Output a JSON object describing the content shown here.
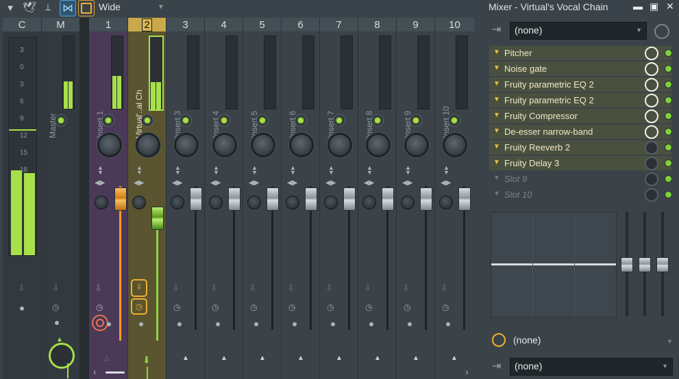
{
  "toolbar": {
    "preset_label": "Wide",
    "icons": [
      "chevron-down-icon",
      "bird-icon",
      "tuning-fork-icon",
      "bowtie-icon",
      "square-icon"
    ]
  },
  "title_bar": {
    "title": "Mixer - Virtual's Vocal Chain",
    "minimize": "▬",
    "maximize": "▣",
    "close": "✕"
  },
  "mixer": {
    "headers": [
      "C",
      "M",
      "1",
      "2",
      "3",
      "4",
      "5",
      "6",
      "7",
      "8",
      "9",
      "10"
    ],
    "insert_labels": [
      "Master",
      "Insert 1",
      "Virtual'..al Chain",
      "Insert 3",
      "Insert 4",
      "Insert 5",
      "Insert 6",
      "Insert 7",
      "Insert 8",
      "Insert 9",
      "Insert 10"
    ],
    "db_scale": [
      "3",
      "0",
      "3",
      "6",
      "9",
      "12",
      "15",
      "18"
    ],
    "selected_track": "2",
    "colors": {
      "track1": "#6a3a8a",
      "track2": "#c9a94a",
      "meter": "#a8e049",
      "fader_orange": "#f0a020",
      "fader_green": "#8fd640",
      "record": "#f07050"
    }
  },
  "fx_panel": {
    "input": "(none)",
    "slots": [
      {
        "name": "Pitcher",
        "filled": true,
        "ring": "light"
      },
      {
        "name": "Noise gate",
        "filled": true,
        "ring": "light"
      },
      {
        "name": "Fruity parametric EQ 2",
        "filled": true,
        "ring": "light"
      },
      {
        "name": "Fruity parametric EQ 2",
        "filled": true,
        "ring": "light"
      },
      {
        "name": "Fruity Compressor",
        "filled": true,
        "ring": "light"
      },
      {
        "name": "De-esser narrow-band",
        "filled": true,
        "ring": "light"
      },
      {
        "name": "Fruity Reeverb 2",
        "filled": true,
        "ring": "dark"
      },
      {
        "name": "Fruity Delay 3",
        "filled": true,
        "ring": "dark"
      },
      {
        "name": "Slot 9",
        "filled": false,
        "ring": "dark"
      },
      {
        "name": "Slot 10",
        "filled": false,
        "ring": "dark"
      }
    ],
    "timing": "(none)",
    "output": "(none)"
  }
}
